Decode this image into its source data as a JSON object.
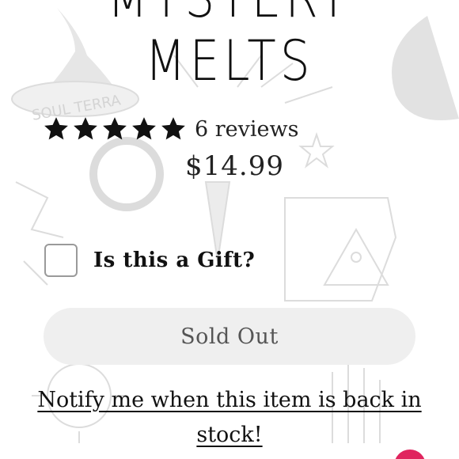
{
  "product": {
    "title_line1": "MYSTERY",
    "title_line2": "MELTS",
    "rating": 5,
    "rating_max": 5,
    "reviews_label": "6 reviews",
    "price": "$14.99"
  },
  "gift_option": {
    "label": "Is this a Gift?",
    "checked": false
  },
  "buy_button": {
    "label": "Sold Out"
  },
  "notify_link": {
    "label": "Notify me when this item is back in stock!"
  },
  "colors": {
    "text": "#111111",
    "button_bg": "#efefef",
    "button_text": "#555555",
    "chat_accent": "#e0245e",
    "background_art": "#d8d8d8"
  },
  "background_watermark": {
    "logo_text": "SOUL TERRA",
    "icons": [
      "witch-hat-icon",
      "crystal-ball-icon",
      "moon-icon",
      "star-icon",
      "pyramid-icon",
      "eye-icon",
      "sun-icon",
      "hand-icon",
      "scroll-icon"
    ]
  }
}
